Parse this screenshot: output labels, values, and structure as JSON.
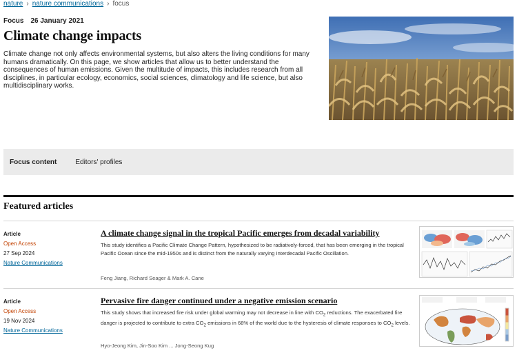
{
  "breadcrumb": {
    "items": [
      "nature",
      "nature communications"
    ],
    "current": "focus",
    "separator": "›"
  },
  "header": {
    "type": "Focus",
    "date": "26 January 2021",
    "title": "Climate change impacts",
    "intro": "Climate change not only affects environmental systems, but also alters the living conditions for many humans dramatically. On this page, we show articles that allow us to better understand the consequences of human emissions. Given the multitude of impacts, this includes research from all disciplines, in particular ecology, economics, social sciences, climatology and life science, but also multidisciplinary works."
  },
  "tabs": [
    {
      "label": "Focus content",
      "active": true
    },
    {
      "label": "Editors' profiles",
      "active": false
    }
  ],
  "section": {
    "title": "Featured articles"
  },
  "articles": [
    {
      "type": "Article",
      "access": "Open Access",
      "date": "27 Sep 2024",
      "journal": "Nature Communications",
      "title": "A climate change signal in the tropical Pacific emerges from decadal variability",
      "description": "This study identifies a Pacific Climate Change Pattern, hypothesized to be radiatively-forced, that has been emerging in the tropical Pacific Ocean since the mid-1950s and is distinct from the naturally varying Interdecadal Pacific Oscillation.",
      "authors": "Feng Jiang, Richard Seager & Mark A. Cane"
    },
    {
      "type": "Article",
      "access": "Open Access",
      "date": "19 Nov 2024",
      "journal": "Nature Communications",
      "title": "Pervasive fire danger continued under a negative emission scenario",
      "description_parts": [
        "This study shows that increased fire risk under global warming may not decrease in line with CO",
        "2",
        " reductions. The exacerbated fire danger is projected to contribute to extra CO",
        "2",
        " emissions in 68% of the world due to the hysteresis of climate responses to CO",
        "2",
        " levels."
      ],
      "authors": "Hyo-Jeong Kim, Jin-Soo Kim ... Jong-Seong Kug"
    }
  ],
  "colors": {
    "link": "#006699",
    "open_access": "#c24100",
    "tab_bar": "#ebebeb"
  }
}
